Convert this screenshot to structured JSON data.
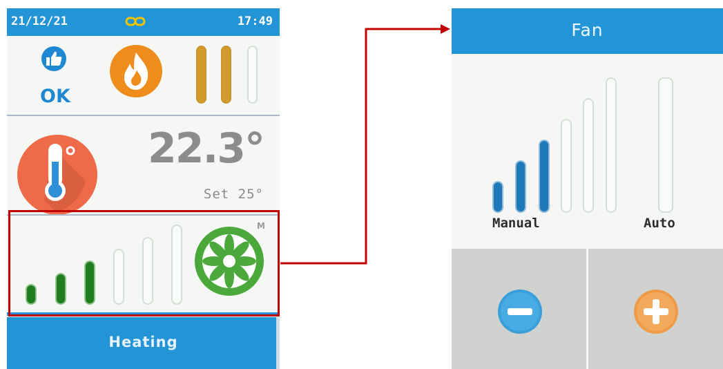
{
  "thermostat": {
    "status_bar": {
      "date": "21/12/21",
      "time": "17:49"
    },
    "ok_label": "OK",
    "temperature": "22.3°",
    "setpoint": "Set 25°",
    "mode_indicator": "M",
    "mode_button_label": "Heating",
    "fan_level_active": 3,
    "fan_level_max": 6
  },
  "fan_screen": {
    "title": "Fan",
    "manual_label": "Manual",
    "auto_label": "Auto",
    "level_active": 3,
    "level_max": 6
  },
  "colors": {
    "accent_blue": "#2395d6",
    "highlight_red": "#c00000",
    "fan_green": "#4aa93a",
    "flame_orange": "#ee8c1c",
    "plus_orange": "#f0a050"
  }
}
